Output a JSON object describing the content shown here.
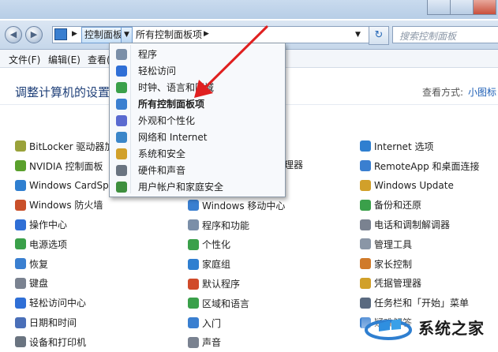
{
  "address": {
    "crumb_active": "控制面板",
    "crumb_current": "所有控制面板项",
    "search_placeholder": "搜索控制面板"
  },
  "menu": [
    "文件(F)",
    "编辑(E)",
    "查看("
  ],
  "header": {
    "title": "调整计算机的设置",
    "view_by_label": "查看方式:",
    "view_by_value": "小图标"
  },
  "dropdown": {
    "items": [
      {
        "label": "程序",
        "icon": "programs-icon",
        "color": "#7b8fa8"
      },
      {
        "label": "轻松访问",
        "icon": "ease-of-access-icon",
        "color": "#2f6fd6"
      },
      {
        "label": "时钟、语言和区域",
        "icon": "clock-globe-icon",
        "color": "#3aa04a"
      },
      {
        "label": "所有控制面板项",
        "icon": "control-panel-icon",
        "color": "#3a7fd0",
        "bold": true
      },
      {
        "label": "外观和个性化",
        "icon": "appearance-icon",
        "color": "#5a6ad0"
      },
      {
        "label": "网络和 Internet",
        "icon": "network-icon",
        "color": "#3b86c9"
      },
      {
        "label": "系统和安全",
        "icon": "system-security-icon",
        "color": "#d1a02a"
      },
      {
        "label": "硬件和声音",
        "icon": "hardware-sound-icon",
        "color": "#6a7480"
      },
      {
        "label": "用户帐户和家庭安全",
        "icon": "user-accounts-icon",
        "color": "#3e8f3e"
      }
    ]
  },
  "columns": {
    "col1": [
      {
        "label": "BitLocker 驱动器加密",
        "icon": "bitlocker-icon",
        "color": "#9aa23a"
      },
      {
        "label": "NVIDIA 控制面板",
        "icon": "nvidia-icon",
        "color": "#5aa02c"
      },
      {
        "label": "Windows CardSpace",
        "icon": "cardspace-icon",
        "color": "#2f7fd0"
      },
      {
        "label": "Windows 防火墙",
        "icon": "firewall-icon",
        "color": "#c9502a"
      },
      {
        "label": "操作中心",
        "icon": "flag-icon",
        "color": "#2f6fd6"
      },
      {
        "label": "电源选项",
        "icon": "power-icon",
        "color": "#3aa04a"
      },
      {
        "label": "恢复",
        "icon": "recovery-icon",
        "color": "#3a7fd0"
      },
      {
        "label": "键盘",
        "icon": "keyboard-icon",
        "color": "#7a8290"
      },
      {
        "label": "轻松访问中心",
        "icon": "ease-of-access-icon",
        "color": "#2f6fd6"
      },
      {
        "label": "日期和时间",
        "icon": "clock-icon",
        "color": "#4a6fb8"
      },
      {
        "label": "设备和打印机",
        "icon": "printer-icon",
        "color": "#6a7480"
      }
    ],
    "col2_partial": [
      "理器"
    ],
    "col2": [
      {
        "label": "Windows 移动中心",
        "icon": "mobility-icon",
        "color": "#3a7fd0"
      },
      {
        "label": "程序和功能",
        "icon": "programs-icon",
        "color": "#7b8fa8"
      },
      {
        "label": "个性化",
        "icon": "personalize-icon",
        "color": "#3aa04a"
      },
      {
        "label": "家庭组",
        "icon": "homegroup-icon",
        "color": "#2f7fd0"
      },
      {
        "label": "默认程序",
        "icon": "default-programs-icon",
        "color": "#d04a2a"
      },
      {
        "label": "区域和语言",
        "icon": "globe-icon",
        "color": "#3aa04a"
      },
      {
        "label": "入门",
        "icon": "getting-started-icon",
        "color": "#3a7fd0"
      },
      {
        "label": "声音",
        "icon": "speaker-icon",
        "color": "#7a8290"
      }
    ],
    "col3": [
      {
        "label": "Internet 选项",
        "icon": "internet-options-icon",
        "color": "#2f7fd0"
      },
      {
        "label": "RemoteApp 和桌面连接",
        "icon": "remoteapp-icon",
        "color": "#3a7fd0"
      },
      {
        "label": "Windows Update",
        "icon": "windows-update-icon",
        "color": "#d1a02a"
      },
      {
        "label": "备份和还原",
        "icon": "backup-icon",
        "color": "#3aa04a"
      },
      {
        "label": "电话和调制解调器",
        "icon": "modem-icon",
        "color": "#7a8290"
      },
      {
        "label": "管理工具",
        "icon": "admin-tools-icon",
        "color": "#8a96a6"
      },
      {
        "label": "家长控制",
        "icon": "parental-controls-icon",
        "color": "#d07a2a"
      },
      {
        "label": "凭据管理器",
        "icon": "credential-icon",
        "color": "#d1a02a"
      },
      {
        "label": "任务栏和「开始」菜单",
        "icon": "taskbar-icon",
        "color": "#5a6a80"
      },
      {
        "label": "疑难解答",
        "icon": "troubleshoot-icon",
        "color": "#3a7fd0"
      }
    ]
  },
  "watermark": {
    "text": "系统之家"
  },
  "colors": {
    "arrow": "#e02020",
    "title": "#1e3f78",
    "link": "#1e5fb6"
  }
}
